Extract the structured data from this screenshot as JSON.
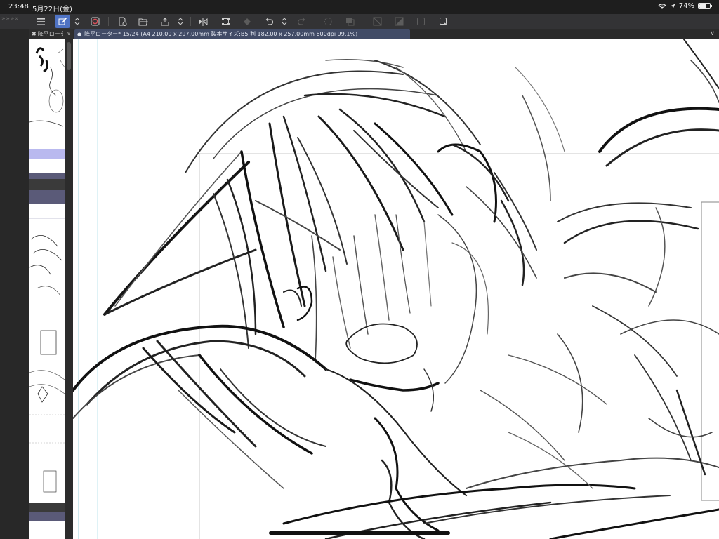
{
  "status_bar": {
    "time": "23:48",
    "date": "5月22日(金)",
    "battery_text": "74%",
    "battery_level": 0.74
  },
  "toolbar": {
    "collapse_label": "» » » »",
    "buttons": [
      {
        "name": "menu-icon"
      },
      {
        "name": "new-canvas-icon"
      },
      {
        "name": "open-file-icon"
      },
      {
        "name": "save-icon"
      },
      {
        "name": "flip-horizontal-icon"
      },
      {
        "name": "transform-icon"
      },
      {
        "name": "fill-icon"
      },
      {
        "name": "undo-icon"
      },
      {
        "name": "redo-icon"
      },
      {
        "name": "selection-launcher-icon"
      },
      {
        "name": "copy-layer-icon"
      },
      {
        "name": "clear-outside-icon"
      },
      {
        "name": "fill-selection-icon"
      },
      {
        "name": "deselect-icon"
      },
      {
        "name": "invert-selection-icon"
      }
    ]
  },
  "navigator": {
    "tab_label": "降平ローター",
    "chevron": "∨"
  },
  "document": {
    "tab_label": "降平ローター* 15/24 (A4 210.00 x 297.00mm 製本サイズ:B5 判 182.00 x 257.00mm 600dpi 99.1%)",
    "tab_dot": "●",
    "chevron": "∨"
  },
  "colors": {
    "toolbar_bg": "#333335",
    "active_tool": "#4f73c4",
    "canvas": "#ffffff",
    "page_selected": "#b9b9ef"
  }
}
